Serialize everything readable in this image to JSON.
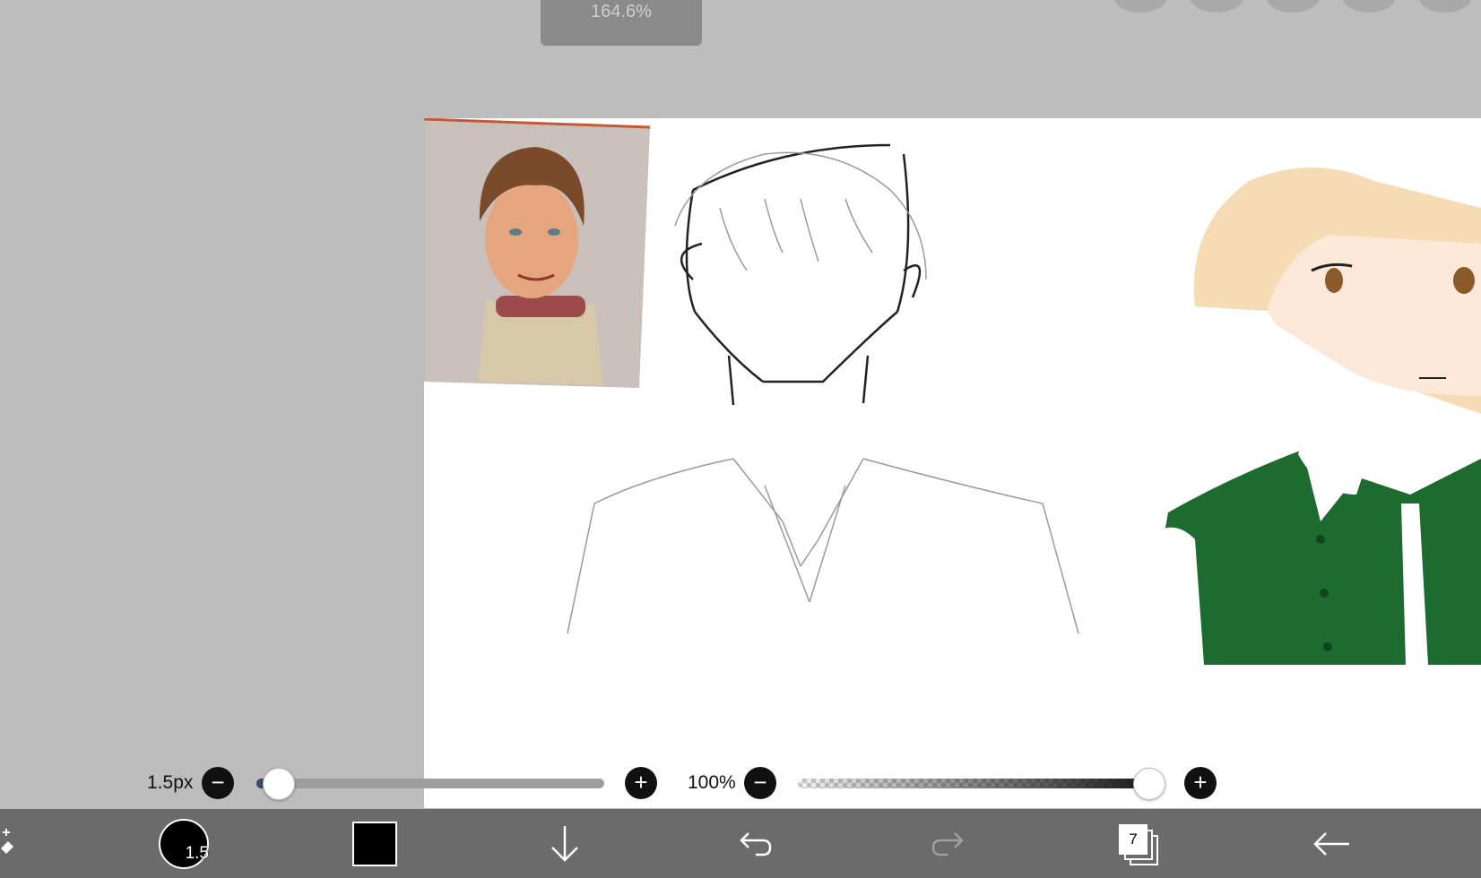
{
  "zoom_indicator": "164.6%",
  "brush": {
    "size_label": "1.5px",
    "size_fraction": 0.03,
    "preview_label": "1.5"
  },
  "opacity": {
    "label": "100%",
    "value_fraction": 1.0
  },
  "buttons": {
    "minus": "−",
    "plus": "+"
  },
  "color": {
    "current": "#000000",
    "canvas_bg": "#ffffff",
    "ui_bg": "#bdbdbd",
    "toolbar_bg": "#6b6b6b"
  },
  "layers": {
    "count": "7"
  },
  "toolbar": {
    "tools": [
      "transform-icon",
      "brush-preview",
      "color-swatch",
      "download-icon",
      "undo-icon",
      "redo-icon",
      "layers-icon",
      "back-arrow-icon"
    ]
  }
}
